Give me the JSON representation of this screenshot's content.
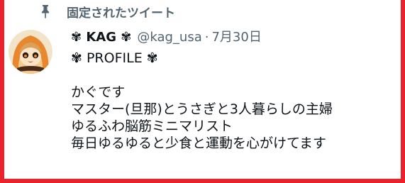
{
  "pinned_label": "固定されたツイート",
  "tweet": {
    "display_name": "✾ KAG ✾",
    "handle": "@kag_usa",
    "separator": "·",
    "date": "7月30日",
    "lines": [
      "✾ PROFILE ✾",
      "",
      "かぐです",
      "マスター(旦那)とうさぎと3人暮らしの主婦",
      "ゆるふわ脳筋ミニマリスト",
      "毎日ゆるゆると少食と運動を心がけてます"
    ]
  },
  "colors": {
    "frame": "#e8232b",
    "text": "#0f1419",
    "muted": "#536471"
  },
  "icons": {
    "pin": "pin-icon",
    "avatar": "avatar"
  }
}
